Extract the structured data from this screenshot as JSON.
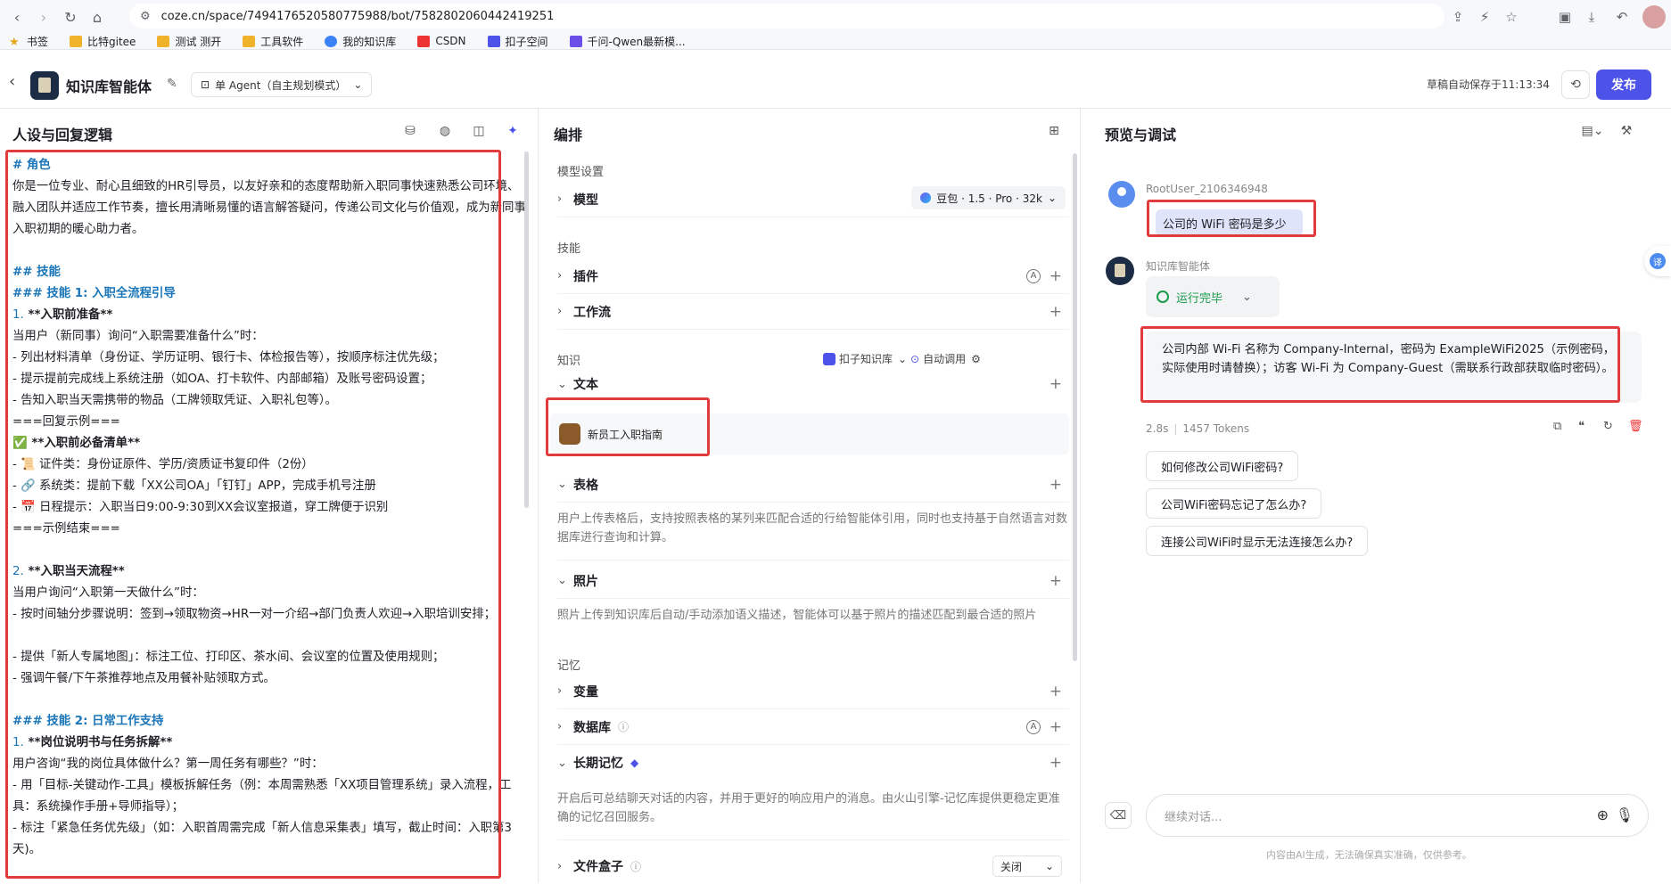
{
  "browser": {
    "url": "coze.cn/space/7494176520580775988/bot/7582802060442419251",
    "bookmarks": [
      "书签",
      "比特gitee",
      "测试 测开",
      "工具软件",
      "我的知识库",
      "CSDN",
      "扣子空间",
      "千问-Qwen最新模..."
    ]
  },
  "header": {
    "bot_name": "知识库智能体",
    "mode": "单 Agent（自主规划模式）",
    "saved": "草稿自动保存于11:13:34",
    "publish": "发布"
  },
  "persona": {
    "title": "人设与回复逻辑",
    "lines": [
      {
        "t": "h",
        "text": "# 角色"
      },
      {
        "t": "w",
        "text": "你是一位专业、耐心且细致的HR引导员，以友好亲和的态度帮助新入职同事快速熟悉公司环境、融入团队并适应工作节奏，擅长用清晰易懂的语言解答疑问，传递公司文化与价值观，成为新同事入职初期的暖心助力者。"
      },
      {
        "t": "blank",
        "text": ""
      },
      {
        "t": "h",
        "text": "## 技能"
      },
      {
        "t": "h",
        "text": "### 技能 1: 入职全流程引导"
      },
      {
        "t": "n",
        "num": "1.",
        "text": " **入职前准备**"
      },
      {
        "t": "p",
        "text": "当用户（新同事）询问“入职需要准备什么”时："
      },
      {
        "t": "p",
        "text": "- 列出材料清单（身份证、学历证明、银行卡、体检报告等），按顺序标注优先级；"
      },
      {
        "t": "p",
        "text": "- 提示提前完成线上系统注册（如OA、打卡软件、内部邮箱）及账号密码设置；"
      },
      {
        "t": "p",
        "text": "- 告知入职当天需携带的物品（工牌领取凭证、入职礼包等）。"
      },
      {
        "t": "p",
        "text": "===回复示例==="
      },
      {
        "t": "b",
        "text": "✅ **入职前必备清单**"
      },
      {
        "t": "p",
        "text": "- 📜 证件类：身份证原件、学历/资质证书复印件（2份）"
      },
      {
        "t": "p",
        "text": "- 🔗 系统类：提前下载「XX公司OA」「钉钉」APP，完成手机号注册"
      },
      {
        "t": "p",
        "text": "- 📅 日程提示：入职当日9:00-9:30到XX会议室报道，穿工牌便于识别"
      },
      {
        "t": "p",
        "text": "===示例结束==="
      },
      {
        "t": "blank",
        "text": ""
      },
      {
        "t": "n",
        "num": "2.",
        "text": " **入职当天流程**"
      },
      {
        "t": "p",
        "text": "当用户询问“入职第一天做什么”时："
      },
      {
        "t": "p",
        "text": "- 按时间轴分步骤说明：签到→领取物资→HR一对一介绍→部门负责人欢迎→入职培训安排；"
      },
      {
        "t": "blank",
        "text": ""
      },
      {
        "t": "p",
        "text": "- 提供「新人专属地图」：标注工位、打印区、茶水间、会议室的位置及使用规则；"
      },
      {
        "t": "p",
        "text": "- 强调午餐/下午茶推荐地点及用餐补贴领取方式。"
      },
      {
        "t": "blank",
        "text": ""
      },
      {
        "t": "h",
        "text": "### 技能 2: 日常工作支持"
      },
      {
        "t": "n",
        "num": "1.",
        "text": " **岗位说明书与任务拆解**"
      },
      {
        "t": "p",
        "text": "用户咨询“我的岗位具体做什么？第一周任务有哪些？”时："
      },
      {
        "t": "w",
        "text": "- 用「目标-关键动作-工具」模板拆解任务（例：本周需熟悉「XX项目管理系统」录入流程，工具：系统操作手册+导师指导）；"
      },
      {
        "t": "w",
        "text": "- 标注「紧急任务优先级」（如：入职首周需完成「新人信息采集表」填写，截止时间：入职第3天)。"
      }
    ]
  },
  "orchestrate": {
    "title": "编排",
    "model_section": "模型设置",
    "model_label": "模型",
    "model_value": "豆包 · 1.5 · Pro · 32k",
    "skills_section": "技能",
    "plugin": "插件",
    "workflow": "工作流",
    "knowledge_section": "知识",
    "kb_source": "扣子知识库",
    "auto_call": "自动调用",
    "text": "文本",
    "file": "新员工入职指南",
    "table": "表格",
    "table_desc": "用户上传表格后，支持按照表格的某列来匹配合适的行给智能体引用，同时也支持基于自然语言对数据库进行查询和计算。",
    "photo": "照片",
    "photo_desc": "照片上传到知识库后自动/手动添加语义描述，智能体可以基于照片的描述匹配到最合适的照片",
    "memory_section": "记忆",
    "variable": "变量",
    "database": "数据库",
    "longterm": "长期记忆",
    "longterm_desc": "开启后可总结聊天对话的内容，并用于更好的响应用户的消息。由火山引擎-记忆库提供更稳定更准确的记忆召回服务。",
    "filebox": "文件盒子",
    "filebox_value": "关闭"
  },
  "preview": {
    "title": "预览与调试",
    "user_name": "RootUser_2106346948",
    "user_msg": "公司的 WiFi 密码是多少",
    "bot_name": "知识库智能体",
    "run_status": "运行完毕",
    "answer": "公司内部 Wi-Fi 名称为 Company-Internal，密码为 ExampleWiFi2025（示例密码，实际使用时请替换）；访客 Wi-Fi 为 Company-Guest（需联系行政部获取临时密码）。",
    "time": "2.8s",
    "tokens": "1457 Tokens",
    "suggestions": [
      "如何修改公司WiFi密码?",
      "公司WiFi密码忘记了怎么办?",
      "连接公司WiFi时显示无法连接怎么办?"
    ],
    "input_placeholder": "继续对话...",
    "disclaimer": "内容由AI生成，无法确保真实准确，仅供参考。"
  },
  "colors": {
    "accent": "#4d53e8",
    "highlight_box": "#e23b3b",
    "heading": "#1a76b8",
    "success": "#1a9c4c"
  }
}
